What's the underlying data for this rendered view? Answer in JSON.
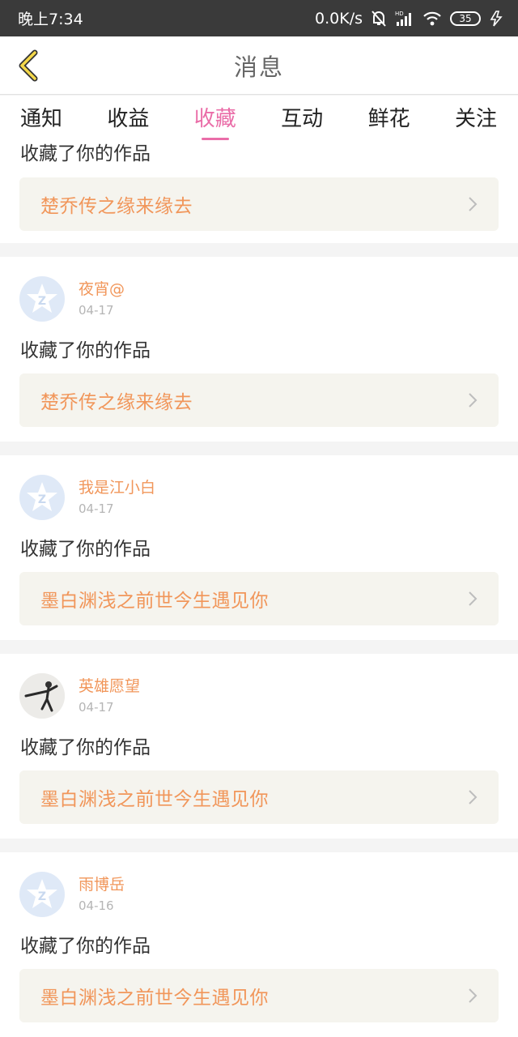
{
  "status_bar": {
    "time": "晚上7:34",
    "network_speed": "0.0K/s",
    "battery": "35"
  },
  "header": {
    "title": "消息"
  },
  "tabs": [
    {
      "label": "通知",
      "active": false
    },
    {
      "label": "收益",
      "active": false
    },
    {
      "label": "收藏",
      "active": true
    },
    {
      "label": "互动",
      "active": false
    },
    {
      "label": "鲜花",
      "active": false
    },
    {
      "label": "关注",
      "active": false
    }
  ],
  "partial_item": {
    "action": "收藏了你的作品",
    "work_title": "楚乔传之缘来缘去"
  },
  "items": [
    {
      "username": "夜宵@",
      "date": "04-17",
      "action": "收藏了你的作品",
      "work_title": "楚乔传之缘来缘去",
      "avatar": "default-avatar"
    },
    {
      "username": "我是江小白",
      "date": "04-17",
      "action": "收藏了你的作品",
      "work_title": "墨白渊浅之前世今生遇见你",
      "avatar": "default-avatar"
    },
    {
      "username": "英雄愿望",
      "date": "04-17",
      "action": "收藏了你的作品",
      "work_title": "墨白渊浅之前世今生遇见你",
      "avatar": "photo-avatar"
    },
    {
      "username": "雨博岳",
      "date": "04-16",
      "action": "收藏了你的作品",
      "work_title": "墨白渊浅之前世今生遇见你",
      "avatar": "default-avatar"
    }
  ],
  "colors": {
    "accent": "#ea6da8",
    "username": "#f1965a",
    "work_title": "#f1965a",
    "work_box_bg": "#f5f4ee"
  }
}
